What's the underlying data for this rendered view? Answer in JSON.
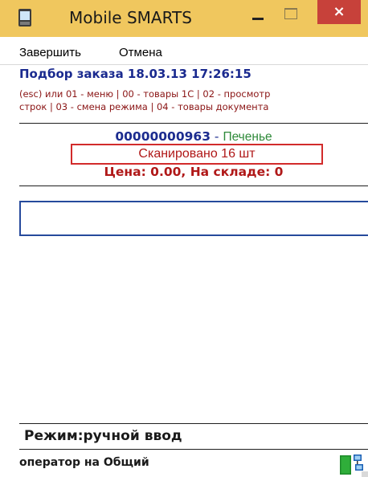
{
  "window": {
    "title": "Mobile SMARTS",
    "close_glyph": "×"
  },
  "menu": {
    "items": [
      "Завершить",
      "Отмена"
    ]
  },
  "header": {
    "title": "Подбор заказа 18.03.13 17:26:15"
  },
  "hints": {
    "line1": "(esc) или 01 - меню | 00 - товары 1С | 02 - просмотр",
    "line2": "строк | 03 - смена режима | 04 - товары документа"
  },
  "product": {
    "code": "00000000963",
    "separator": " - ",
    "name": "Печенье",
    "scanned": "Сканировано 16 шт",
    "price_stock": "Цена: 0.00, На складе: 0"
  },
  "input": {
    "value": ""
  },
  "footer": {
    "mode": "Режим:ручной ввод",
    "operator": "оператор на Общий"
  },
  "colors": {
    "titlebar": "#f0c75e",
    "close_button": "#c7413a",
    "header_text": "#1a2a8f",
    "hint_text": "#8a1414",
    "product_name": "#2f8a3a",
    "highlight_box": "#d22b2b",
    "input_border": "#264a9c"
  },
  "icons": {
    "app": "mobile-device-icon",
    "status": "network-status-icon"
  }
}
